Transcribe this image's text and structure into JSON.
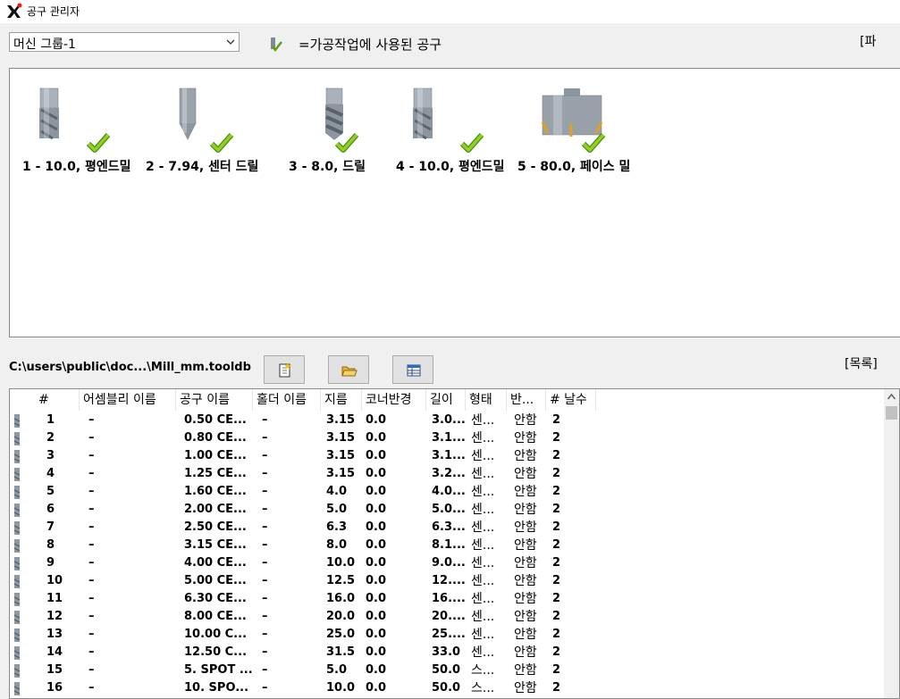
{
  "window": {
    "title": "공구 관리자"
  },
  "machine_group": {
    "selected": "머신 그룹-1"
  },
  "legend": {
    "text": "=가공작업에 사용된 공구"
  },
  "right_tag_top": "[파",
  "used_tools": [
    {
      "label": "1 - 10.0, 평엔드밀",
      "type": "endmill"
    },
    {
      "label": "2 - 7.94, 센터 드릴",
      "type": "centerdrill"
    },
    {
      "label": "3 - 8.0, 드릴",
      "type": "drill"
    },
    {
      "label": "4 - 10.0, 평엔드밀",
      "type": "endmill"
    },
    {
      "label": "5 - 80.0, 페이스 밀",
      "type": "facemill"
    }
  ],
  "library": {
    "path": "C:\\users\\public\\doc...\\Mill_mm.tooldb",
    "right_tag": "[목록]"
  },
  "table": {
    "headers": [
      "#",
      "어셈블리 이름",
      "공구 이름",
      "홀더 이름",
      "지름",
      "코너반경",
      "길이",
      "형태",
      "반...",
      "# 날수"
    ],
    "rows": [
      [
        "1",
        "–",
        "0.50 CE...",
        "–",
        "3.15",
        "0.0",
        "3.0...",
        "센...",
        "안함",
        "2"
      ],
      [
        "2",
        "–",
        "0.80 CE...",
        "–",
        "3.15",
        "0.0",
        "3.1...",
        "센...",
        "안함",
        "2"
      ],
      [
        "3",
        "–",
        "1.00 CE...",
        "–",
        "3.15",
        "0.0",
        "3.1...",
        "센...",
        "안함",
        "2"
      ],
      [
        "4",
        "–",
        "1.25 CE...",
        "–",
        "3.15",
        "0.0",
        "3.2...",
        "센...",
        "안함",
        "2"
      ],
      [
        "5",
        "–",
        "1.60 CE...",
        "–",
        "4.0",
        "0.0",
        "4.0...",
        "센...",
        "안함",
        "2"
      ],
      [
        "6",
        "–",
        "2.00 CE...",
        "–",
        "5.0",
        "0.0",
        "5.0...",
        "센...",
        "안함",
        "2"
      ],
      [
        "7",
        "–",
        "2.50 CE...",
        "–",
        "6.3",
        "0.0",
        "6.3...",
        "센...",
        "안함",
        "2"
      ],
      [
        "8",
        "–",
        "3.15 CE...",
        "–",
        "8.0",
        "0.0",
        "8.1...",
        "센...",
        "안함",
        "2"
      ],
      [
        "9",
        "–",
        "4.00 CE...",
        "–",
        "10.0",
        "0.0",
        "9.0...",
        "센...",
        "안함",
        "2"
      ],
      [
        "10",
        "–",
        "5.00 CE...",
        "–",
        "12.5",
        "0.0",
        "12....",
        "센...",
        "안함",
        "2"
      ],
      [
        "11",
        "–",
        "6.30 CE...",
        "–",
        "16.0",
        "0.0",
        "16....",
        "센...",
        "안함",
        "2"
      ],
      [
        "12",
        "–",
        "8.00 CE...",
        "–",
        "20.0",
        "0.0",
        "20....",
        "센...",
        "안함",
        "2"
      ],
      [
        "13",
        "–",
        "10.00 C...",
        "–",
        "25.0",
        "0.0",
        "25....",
        "센...",
        "안함",
        "2"
      ],
      [
        "14",
        "–",
        "12.50 C...",
        "–",
        "31.5",
        "0.0",
        "33.0",
        "센...",
        "안함",
        "2"
      ],
      [
        "15",
        "–",
        "5. SPOT ...",
        "–",
        "5.0",
        "0.0",
        "50.0",
        "스...",
        "안함",
        "2"
      ],
      [
        "16",
        "–",
        "10. SPO...",
        "–",
        "10.0",
        "0.0",
        "50.0",
        "스...",
        "안함",
        "2"
      ]
    ]
  }
}
